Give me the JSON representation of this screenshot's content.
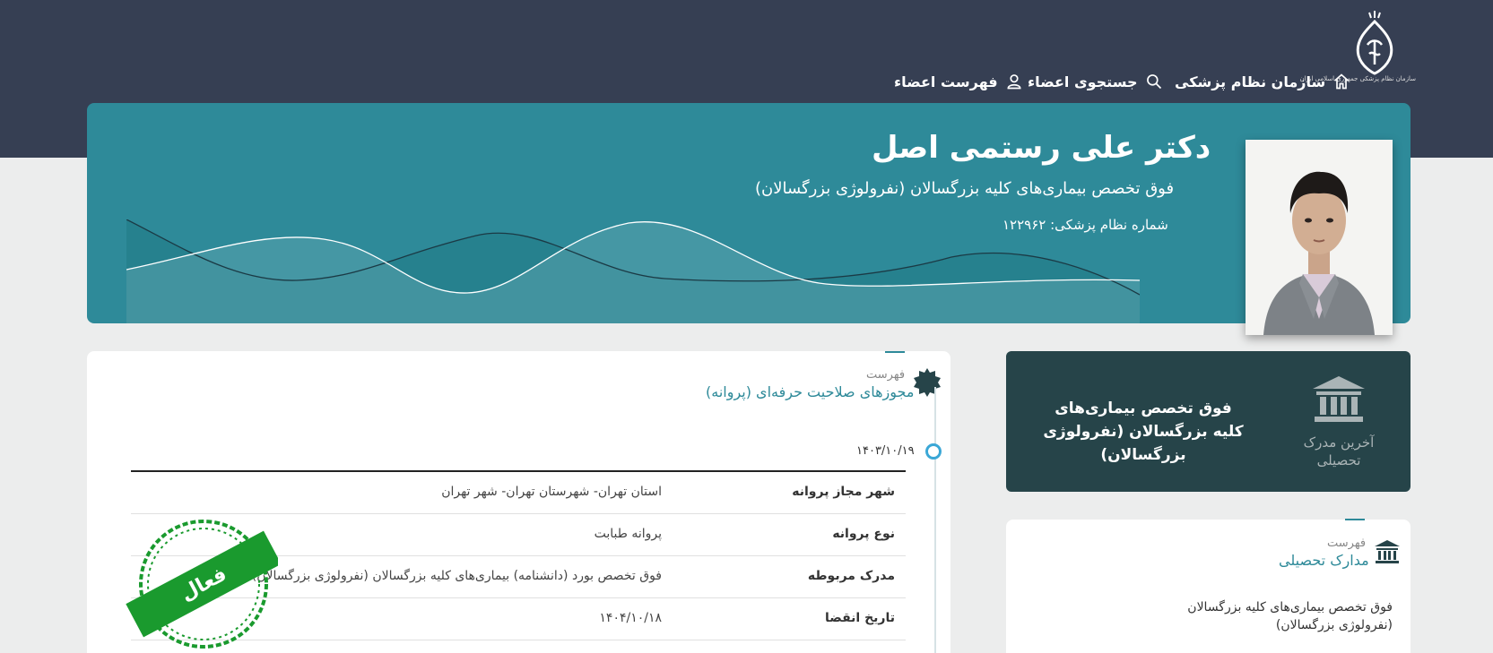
{
  "header": {
    "logo_text": "سازمان نظام پزشکی جمهوری اسلامی ایران",
    "nav": [
      {
        "label": "سازمان نظام پزشکی",
        "icon": "home-icon"
      },
      {
        "label": "جستجوی اعضاء",
        "icon": "search-icon"
      },
      {
        "label": "فهرست اعضاء",
        "icon": "user-icon"
      }
    ]
  },
  "profile": {
    "name": "دکتر علی رستمی اصل",
    "specialty": "فوق تخصص بیماری‌های کلیه بزرگسالان (نفرولوژی بزرگسالان)",
    "number_line": "شماره نظام پزشکی: ۱۲۲۹۶۲"
  },
  "licenses": {
    "small_label": "فهرست",
    "title": "مجوزهای صلاحیت حرفه‌ای (پروانه)",
    "date": "۱۴۰۳/۱۰/۱۹",
    "rows": [
      {
        "key": "شهر مجاز پروانه",
        "value": "استان تهران- شهرستان تهران- شهر تهران"
      },
      {
        "key": "نوع پروانه",
        "value": "پروانه طبابت"
      },
      {
        "key": "مدرک مربوطه",
        "value": "فوق تخصص بورد (دانشنامه) بیماری‌های کلیه بزرگسالان (نفرولوژی بزرگسالان)"
      },
      {
        "key": "تاریخ انقضا",
        "value": "۱۴۰۴/۱۰/۱۸"
      }
    ],
    "stamp_label": "فعال"
  },
  "latest_degree": {
    "label": "آخرین مدرک تحصیلی",
    "value": "فوق تخصص بیماری‌های کلیه بزرگسالان (نفرولوژی بزرگسالان)"
  },
  "degrees": {
    "small_label": "فهرست",
    "title": "مدارک تحصیلی",
    "items": [
      "فوق تخصص بیماری‌های کلیه بزرگسالان (نفرولوژی بزرگسالان)"
    ]
  },
  "colors": {
    "header_bg": "#363f53",
    "hero_bg": "#2e8a99",
    "dark_card": "#264449",
    "stamp_green": "#1a9a2e",
    "timeline_dot": "#3aa7d6"
  }
}
